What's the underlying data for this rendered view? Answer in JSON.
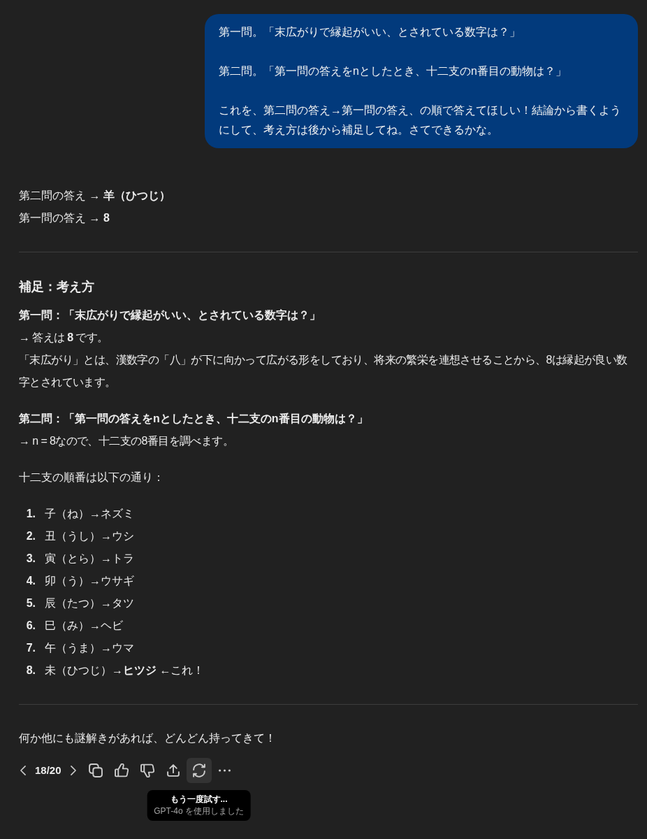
{
  "user_message": {
    "paragraphs": [
      "第一問。「末広がりで縁起がいい、とされている数字は？」",
      "第二問。「第一問の答えをnとしたとき、十二支のn番目の動物は？」",
      "これを、第二問の答え→第一問の答え、の順で答えてほしい！結論から書くようにして、考え方は後から補足してね。さてできるかな。"
    ]
  },
  "assistant_message": {
    "blocks": [
      {
        "kind": "lines",
        "lines": [
          "第二問の答え → **羊（ひつじ）**",
          "第一問の答え → **8**"
        ]
      },
      {
        "kind": "rule"
      },
      {
        "kind": "heading",
        "text": "補足：考え方"
      },
      {
        "kind": "section",
        "title": "第一問：「末広がりで縁起がいい、とされている数字は？」",
        "lines": [
          "→ 答えは **8** です。",
          "「末広がり」とは、漢数字の「八」が下に向かって広がる形をしており、将来の繁栄を連想させることから、8は縁起が良い数字とされています。"
        ]
      },
      {
        "kind": "section",
        "title": "第二問：「第一問の答えをnとしたとき、十二支のn番目の動物は？」",
        "lines": [
          "→ n = 8なので、十二支の8番目を調べます。"
        ]
      },
      {
        "kind": "lines",
        "lines": [
          "十二支の順番は以下の通り："
        ]
      },
      {
        "kind": "ordered_list",
        "items": [
          {
            "number": "1.",
            "text": "子（ね）→ネズミ"
          },
          {
            "number": "2.",
            "text": "丑（うし）→ウシ"
          },
          {
            "number": "3.",
            "text": "寅（とら）→トラ"
          },
          {
            "number": "4.",
            "text": "卯（う）→ウサギ"
          },
          {
            "number": "5.",
            "text": "辰（たつ）→タツ"
          },
          {
            "number": "6.",
            "text": "巳（み）→ヘビ"
          },
          {
            "number": "7.",
            "text": "午（うま）→ウマ"
          },
          {
            "number": "8.",
            "text": "未（ひつじ）→**ヒツジ** ←これ！"
          }
        ]
      },
      {
        "kind": "rule"
      },
      {
        "kind": "lines",
        "lines": [
          "何か他にも謎解きがあれば、どんどん持ってきて！"
        ]
      }
    ],
    "toolbar": {
      "pager": "18/20",
      "actions": [
        {
          "kind": "copy",
          "hovered": false
        },
        {
          "kind": "like",
          "hovered": false
        },
        {
          "kind": "dislike",
          "hovered": false
        },
        {
          "kind": "share",
          "hovered": false
        },
        {
          "kind": "regenerate",
          "hovered": true,
          "tooltip": {
            "title": "もう一度試す...",
            "subtitle": "GPT-4o を使用しました"
          }
        },
        {
          "kind": "more",
          "hovered": false
        }
      ]
    }
  }
}
